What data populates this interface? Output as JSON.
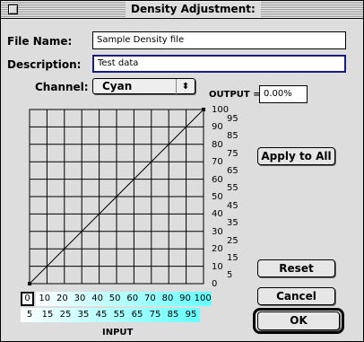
{
  "window": {
    "title": "Density Adjustment:"
  },
  "file_name": {
    "label": "File Name:",
    "value": "Sample Density file"
  },
  "description": {
    "label": "Description:",
    "value": "Test data"
  },
  "channel": {
    "label": "Channel:",
    "value": "Cyan",
    "arrows": "⬍"
  },
  "output": {
    "label": "OUTPUT =",
    "value": "0.00%"
  },
  "buttons": {
    "apply_all": "Apply to All",
    "reset": "Reset",
    "cancel": "Cancel",
    "ok": "OK"
  },
  "output_scale": {
    "major": [
      "100",
      "90",
      "80",
      "70",
      "60",
      "50",
      "40",
      "30",
      "20",
      "10",
      "0"
    ],
    "minor": [
      "95",
      "85",
      "75",
      "65",
      "55",
      "45",
      "35",
      "25",
      "15",
      "5"
    ]
  },
  "input_scale": {
    "selected": "0",
    "major": [
      "10",
      "20",
      "30",
      "40",
      "50",
      "60",
      "70",
      "80",
      "90",
      "100"
    ],
    "minor": [
      "5",
      "15",
      "25",
      "35",
      "45",
      "55",
      "65",
      "75",
      "85",
      "95"
    ],
    "label": "INPUT",
    "highlight_color": "#66ffff"
  },
  "curve": {
    "points": [
      [
        0,
        0
      ],
      [
        100,
        100
      ]
    ]
  }
}
